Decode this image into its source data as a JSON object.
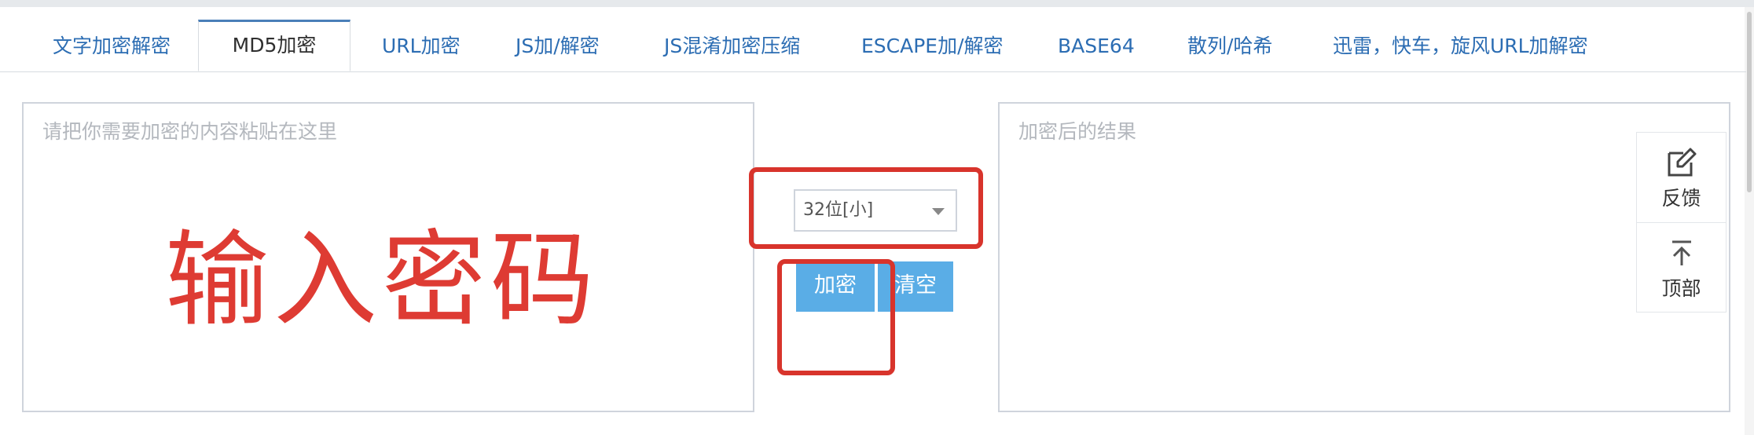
{
  "tabs": [
    {
      "label": "文字加密解密",
      "active": false
    },
    {
      "label": "MD5加密",
      "active": true
    },
    {
      "label": "URL加密",
      "active": false
    },
    {
      "label": "JS加/解密",
      "active": false
    },
    {
      "label": "JS混淆加密压缩",
      "active": false
    },
    {
      "label": "ESCAPE加/解密",
      "active": false
    },
    {
      "label": "BASE64",
      "active": false
    },
    {
      "label": "散列/哈希",
      "active": false
    },
    {
      "label": "迅雷，快车，旋风URL加解密",
      "active": false
    }
  ],
  "input_panel": {
    "placeholder": "请把你需要加密的内容粘贴在这里",
    "value": ""
  },
  "output_panel": {
    "placeholder": "加密后的结果",
    "value": ""
  },
  "overlay": {
    "text": "输入密码",
    "color": "#de3b33"
  },
  "select": {
    "value": "32位[小]"
  },
  "buttons": {
    "encrypt": "加密",
    "clear": "清空"
  },
  "float_menu": {
    "feedback": "反馈",
    "top": "顶部"
  },
  "colors": {
    "accent": "#2c6db3",
    "button": "#5aade6",
    "annotation": "#d8342c"
  },
  "icons": {
    "feedback": "edit-icon",
    "top": "arrow-up-icon",
    "select": "caret-down-icon"
  }
}
